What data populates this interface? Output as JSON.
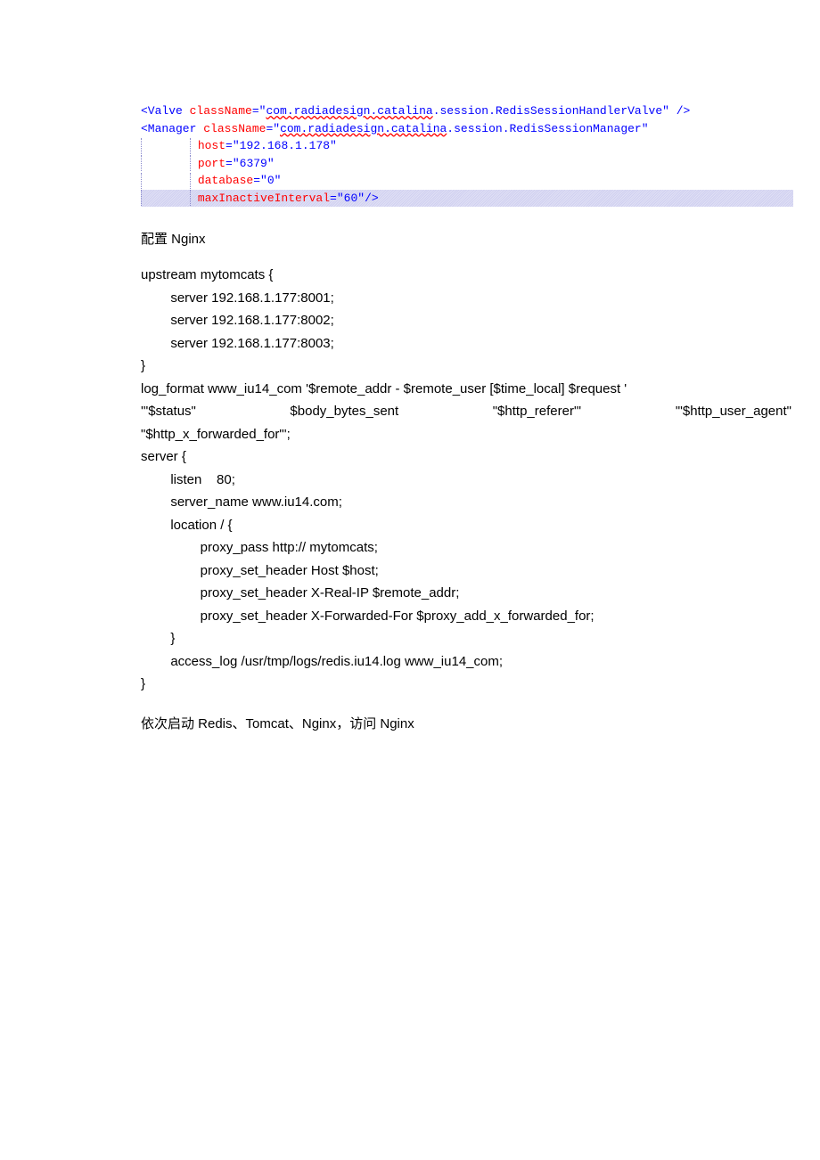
{
  "xml": {
    "line1": {
      "open": "<Valve ",
      "attr1": "className",
      "eq": "=",
      "q": "\"",
      "link": "com.radiadesign.catalina",
      "rest": ".session.RedisSessionHandlerValve\"",
      "close": " />"
    },
    "line2": {
      "open": "<Manager ",
      "attr1": "className",
      "eq": "=",
      "q": "\"",
      "link": "com.radiadesign.catalina",
      "rest": ".session.RedisSessionManager\""
    },
    "line3": {
      "attr": "host",
      "eq": "=",
      "val": "\"192.168.1.178\""
    },
    "line4": {
      "attr": "port",
      "eq": "=",
      "val": "\"6379\""
    },
    "line5": {
      "attr": "database",
      "eq": "=",
      "val": "\"0\""
    },
    "line6": {
      "attr": "maxInactiveInterval",
      "eq": "=",
      "val": "\"60\"",
      "close": "/>"
    }
  },
  "heading1": "配置 Nginx",
  "nginx": {
    "l1": "upstream mytomcats {",
    "l2": "        server 192.168.1.177:8001;",
    "l3": "        server 192.168.1.177:8002;",
    "l4": "        server 192.168.1.177:8003;",
    "l5": "}",
    "l6a": "log_format www_iu14_com '$remote_addr - $remote_user [$time_local] $request '",
    "l7_parts": {
      "a": "'\"$status\"",
      "b": "$body_bytes_sent",
      "c": "\"$http_referer\"'",
      "d": "'\"$http_user_agent\""
    },
    "l8": "\"$http_x_forwarded_for\"';",
    "l9": "server {",
    "l10": "        listen    80;",
    "l11": "        server_name www.iu14.com;",
    "l12": "        location / {",
    "l13": "                proxy_pass http:// mytomcats;",
    "l14": "                proxy_set_header Host $host;",
    "l15": "                proxy_set_header X-Real-IP $remote_addr;",
    "l16": "                proxy_set_header X-Forwarded-For $proxy_add_x_forwarded_for;",
    "l17": "        }",
    "l18": "        access_log /usr/tmp/logs/redis.iu14.log www_iu14_com;",
    "l19": "}"
  },
  "endtext": "依次启动 Redis、Tomcat、Nginx，访问 Nginx"
}
